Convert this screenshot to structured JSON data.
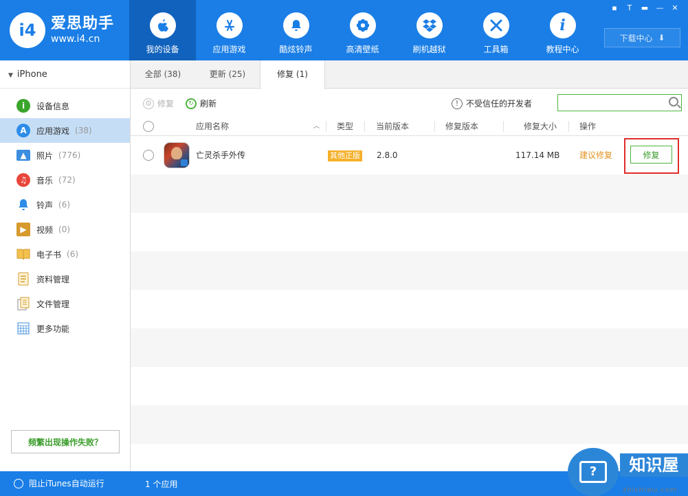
{
  "app": {
    "logo_badge": "i4",
    "logo_name": "爱思助手",
    "logo_url": "www.i4.cn"
  },
  "nav": [
    {
      "label": "我的设备",
      "icon": "apple-icon",
      "glyph": ""
    },
    {
      "label": "应用游戏",
      "icon": "app-store-icon",
      "glyph": "A"
    },
    {
      "label": "酷炫铃声",
      "icon": "bell-icon",
      "glyph": "♪"
    },
    {
      "label": "高清壁纸",
      "icon": "flower-icon",
      "glyph": "❀"
    },
    {
      "label": "刷机越狱",
      "icon": "dropbox-icon",
      "glyph": "◆"
    },
    {
      "label": "工具箱",
      "icon": "tools-icon",
      "glyph": "✕"
    },
    {
      "label": "教程中心",
      "icon": "info-icon",
      "glyph": "i"
    }
  ],
  "window_controls": [
    "▪",
    "T",
    "▬",
    "—",
    "✕"
  ],
  "download_center": {
    "label": "下载中心",
    "icon": "download-icon"
  },
  "sidebar": {
    "device": "iPhone",
    "items": [
      {
        "label": "设备信息",
        "count": "",
        "icon": "info-circle-icon",
        "color": "#3aa52b"
      },
      {
        "label": "应用游戏",
        "count": "(38)",
        "icon": "app-store-icon",
        "color": "#2d8ce8"
      },
      {
        "label": "照片",
        "count": "(776)",
        "icon": "photo-icon",
        "color": "#3b8ee0"
      },
      {
        "label": "音乐",
        "count": "(72)",
        "icon": "music-icon",
        "color": "#e8463a"
      },
      {
        "label": "铃声",
        "count": "(6)",
        "icon": "bell-icon",
        "color": "#2d8ce8"
      },
      {
        "label": "视频",
        "count": "(0)",
        "icon": "video-icon",
        "color": "#d69a2d"
      },
      {
        "label": "电子书",
        "count": "(6)",
        "icon": "book-icon",
        "color": "#e6a92b"
      },
      {
        "label": "资料管理",
        "count": "",
        "icon": "contacts-icon",
        "color": "#e6a92b"
      },
      {
        "label": "文件管理",
        "count": "",
        "icon": "file-icon",
        "color": "#e6a92b"
      },
      {
        "label": "更多功能",
        "count": "",
        "icon": "grid-icon",
        "color": "#3b8ee0"
      }
    ],
    "fail_button": "频繁出现操作失败？"
  },
  "tabs": [
    {
      "label": "全部 (38)"
    },
    {
      "label": "更新 (25)"
    },
    {
      "label": "修复 (1)"
    }
  ],
  "toolbar": {
    "repair": "修复",
    "refresh": "刷新",
    "untrusted": "不受信任的开发者",
    "search_placeholder": ""
  },
  "table": {
    "columns": [
      "应用名称",
      "类型",
      "当前版本",
      "修复版本",
      "修复大小",
      "操作"
    ],
    "rows": [
      {
        "name": "亡灵杀手外传",
        "type": "其他正版",
        "current_version": "2.8.0",
        "repair_version": "",
        "size": "117.14 MB",
        "suggest": "建议修复",
        "action": "修复"
      }
    ]
  },
  "statusbar": {
    "itunes": "阻止iTunes自动运行",
    "app_count": "1 个应用"
  },
  "watermark": {
    "text": "知识屋",
    "url": "zhishiwu.com"
  }
}
